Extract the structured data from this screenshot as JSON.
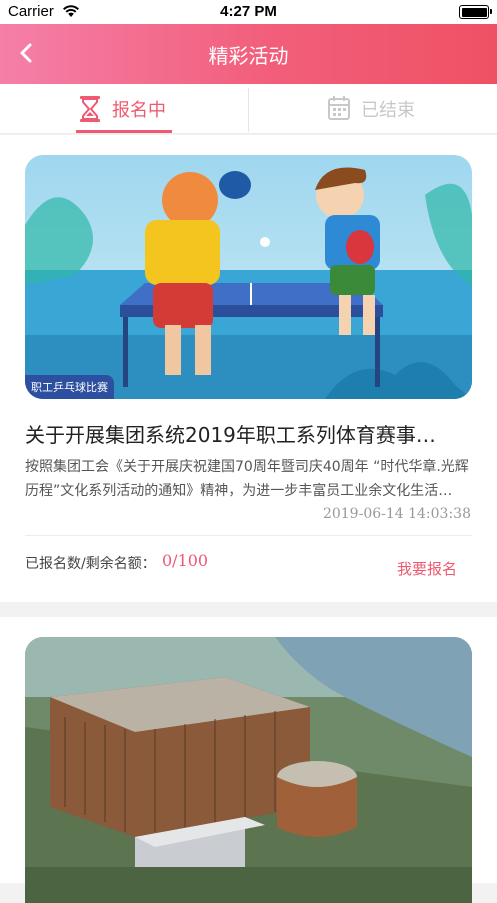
{
  "status_bar": {
    "carrier": "Carrier",
    "time": "4:27 PM"
  },
  "navbar": {
    "title": "精彩活动"
  },
  "tabs": [
    {
      "label": "报名中",
      "active": true,
      "icon": "hourglass-icon"
    },
    {
      "label": "已结束",
      "active": false,
      "icon": "calendar-icon"
    }
  ],
  "activities": [
    {
      "image_tag": "职工乒乓球比赛",
      "title": "关于开展集团系统2019年职工系列体育赛事…",
      "description": "按照集团工会《关于开展庆祝建国70周年暨司庆40周年 “时代华章.光辉历程”文化系列活动的通知》精神，为进一步丰富员工业余文化生活…",
      "date": "2019-06-14 14:03:38",
      "quota_label": "已报名数/剩余名额：",
      "quota_value": "0/100",
      "action_label": "我要报名"
    }
  ],
  "colors": {
    "accent": "#ef5a72",
    "nav_gradient_start": "#f57fa8",
    "nav_gradient_end": "#ef5164"
  }
}
